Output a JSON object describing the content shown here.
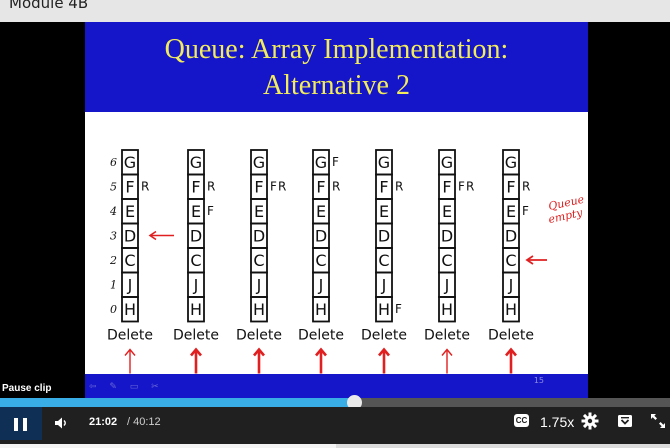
{
  "page": {
    "module_title": "Module 4B"
  },
  "slide": {
    "title_line1": "Queue: Array Implementation:",
    "title_line2": "Alternative 2",
    "slide_number": "15",
    "pen_tools": "⇦ ✎ ▭ ✂"
  },
  "diagram": {
    "row_numbers": [
      "6",
      "5",
      "4",
      "3",
      "2",
      "1",
      "0"
    ],
    "cells": [
      "G",
      "F",
      "E",
      "D",
      "C",
      "J",
      "H"
    ],
    "delete_label": "Delete",
    "note": [
      "Queue",
      "empty"
    ],
    "columns": [
      {
        "F": null,
        "R": 5,
        "show_row_numbers": true,
        "arrow": "thin"
      },
      {
        "F": 4,
        "R": 5,
        "arrow": "bold"
      },
      {
        "F": 5,
        "R": 5,
        "arrow": "bold"
      },
      {
        "F": 6,
        "R": 5,
        "arrow": "bold"
      },
      {
        "F": 0,
        "R": 5,
        "arrow": "bold"
      },
      {
        "F": 5,
        "R": 5,
        "arrow": "thin"
      },
      {
        "F": 4,
        "R": 5,
        "arrow": "bold",
        "empty": true
      }
    ],
    "markers": {
      "front": "F",
      "rear": "R"
    },
    "colors": {
      "ink": "#111111",
      "note": "#e02020"
    }
  },
  "player": {
    "pause_tooltip": "Pause clip",
    "current_time": "21:02",
    "duration": "/ 40:12",
    "speed": "1.75x",
    "cc_label": "CC",
    "progress_fraction": 0.528,
    "accent_color": "#39aee6",
    "icons": [
      "pause-icon",
      "volume-icon",
      "closed-captions-icon",
      "gear-icon",
      "tray-icon",
      "fullscreen-icon"
    ]
  }
}
